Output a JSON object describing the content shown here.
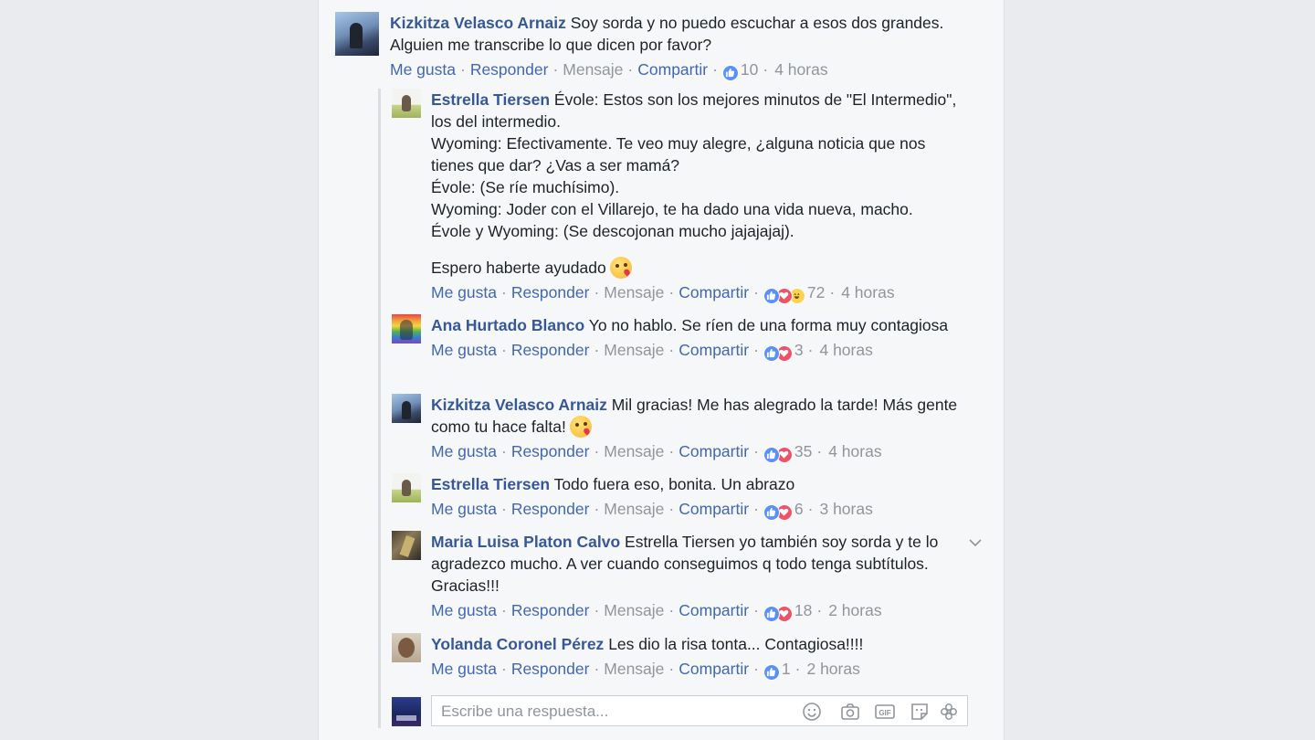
{
  "colors": {
    "link": "#365899",
    "action": "#4267b2",
    "muted": "#90949c",
    "text": "#1d2129",
    "like": "#5890ff",
    "love": "#f25268",
    "haha": "#fcd34f"
  },
  "actions": {
    "like": "Me gusta",
    "reply": "Responder",
    "message": "Mensaje",
    "share": "Compartir",
    "separator": "·"
  },
  "top_comment": {
    "author": "Kizkitza Velasco Arnaiz",
    "text": "Soy sorda y no puedo escuchar a esos dos grandes. Alguien me transcribe lo que dicen por favor?",
    "reactions": [
      "like"
    ],
    "count": "10",
    "time": "4 horas"
  },
  "replies": [
    {
      "author": "Estrella Tiersen",
      "avatar": "avatar-estrella",
      "lines": [
        "Évole: Estos son los mejores minutos de \"El Intermedio\", los del intermedio.",
        "Wyoming: Efectivamente. Te veo muy alegre, ¿alguna noticia que nos tienes que dar? ¿Vas a ser mamá?",
        "Évole: (Se ríe muchísimo).",
        "Wyoming: Joder con el Villarejo, te ha dado una vida nueva, macho.",
        "Évole y Wyoming: (Se descojonan mucho jajajajaj)."
      ],
      "closing": "Espero haberte ayudado",
      "emoji": "kissing-face-emoji",
      "reactions": [
        "like",
        "love",
        "haha"
      ],
      "count": "72",
      "time": "4 horas"
    },
    {
      "author": "Ana Hurtado Blanco",
      "text": "Yo no hablo. Se ríen de una forma muy contagiosa",
      "reactions": [
        "like",
        "love"
      ],
      "count": "3",
      "time": "4 horas"
    },
    {
      "author": "Kizkitza Velasco Arnaiz",
      "text": "Mil gracias! Me has alegrado la tarde! Más gente como tu hace falta!",
      "emoji": "kissing-face-emoji",
      "reactions": [
        "like",
        "love"
      ],
      "count": "35",
      "time": "4 horas"
    },
    {
      "author": "Estrella Tiersen",
      "text": "Todo fuera eso, bonita. Un abrazo",
      "reactions": [
        "like",
        "love"
      ],
      "count": "6",
      "time": "3 horas"
    },
    {
      "author": "Maria Luisa Platon Calvo",
      "text": "Estrella Tiersen yo también soy sorda y te lo agradezco mucho. A ver cuando conseguimos q todo tenga subtítulos. Gracias!!!",
      "reactions": [
        "like",
        "love"
      ],
      "count": "18",
      "time": "2 horas",
      "menu_icon": "chevron-down-icon"
    },
    {
      "author": "Yolanda Coronel Pérez",
      "text": "Les dio la risa tonta... Contagiosa!!!!",
      "reactions": [
        "like"
      ],
      "count": "1",
      "time": "2 horas"
    }
  ],
  "composer": {
    "placeholder": "Escribe una respuesta...",
    "icons": [
      "smiley-icon",
      "camera-icon",
      "gif-icon",
      "sticker-icon",
      "flower-icon"
    ]
  }
}
